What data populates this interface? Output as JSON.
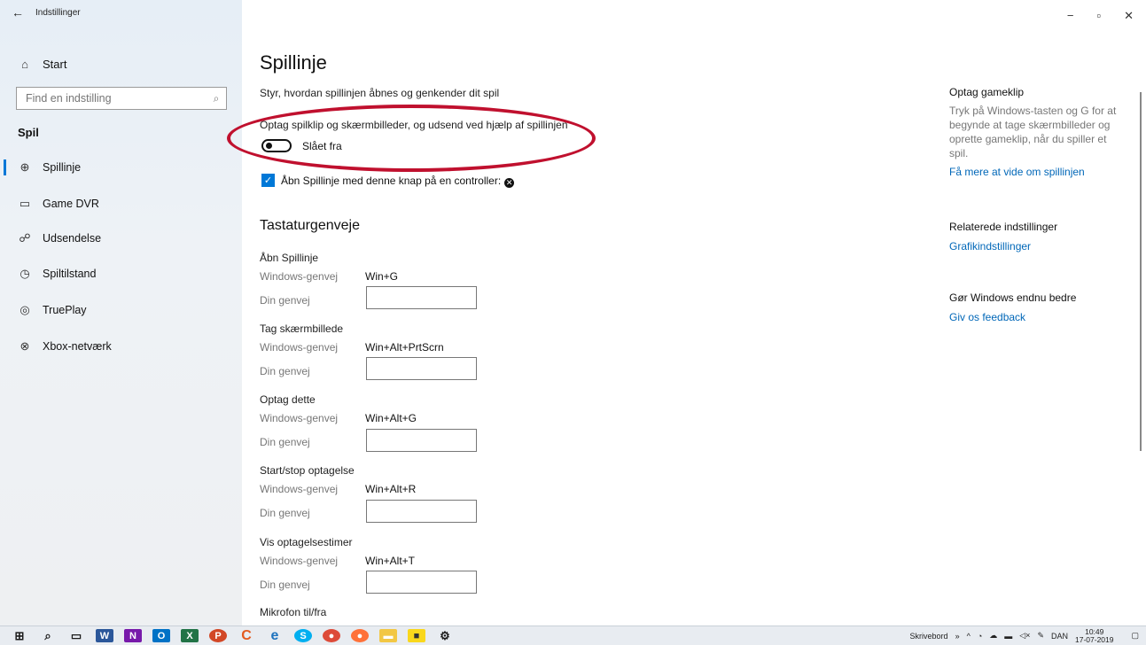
{
  "window": {
    "title": "Indstillinger",
    "back_icon": "←",
    "controls": {
      "minimize": "−",
      "maximize": "▫",
      "close": "✕"
    }
  },
  "sidebar": {
    "home_label": "Start",
    "search_placeholder": "Find en indstilling",
    "section_label": "Spil",
    "items": [
      {
        "label": "Spillinje",
        "icon": "game-bar-icon",
        "glyph": "⊕",
        "active": true
      },
      {
        "label": "Game DVR",
        "icon": "game-dvr-icon",
        "glyph": "▭",
        "active": false
      },
      {
        "label": "Udsendelse",
        "icon": "broadcast-icon",
        "glyph": "☍",
        "active": false
      },
      {
        "label": "Spiltilstand",
        "icon": "game-mode-icon",
        "glyph": "◷",
        "active": false
      },
      {
        "label": "TruePlay",
        "icon": "trueplay-icon",
        "glyph": "◎",
        "active": false
      },
      {
        "label": "Xbox-netværk",
        "icon": "xbox-icon",
        "glyph": "⊗",
        "active": false
      }
    ]
  },
  "main": {
    "title": "Spillinje",
    "subtitle": "Styr, hvordan spillinjen åbnes og genkender dit spil",
    "toggle_label": "Optag spilklip og skærmbilleder, og udsend ved hjælp af spillinjen",
    "toggle_state": "Slået fra",
    "toggle_on": false,
    "checkbox_label": "Åbn Spillinje med denne knap på en controller:",
    "checkbox_checked": true,
    "shortcuts_title": "Tastaturgenveje",
    "key_label": "Windows-genvej",
    "custom_label": "Din genvej",
    "shortcuts": [
      {
        "title": "Åbn Spillinje",
        "keys": "Win+G"
      },
      {
        "title": "Tag skærmbillede",
        "keys": "Win+Alt+PrtScrn"
      },
      {
        "title": "Optag dette",
        "keys": "Win+Alt+G"
      },
      {
        "title": "Start/stop optagelse",
        "keys": "Win+Alt+R"
      },
      {
        "title": "Vis optagelsestimer",
        "keys": "Win+Alt+T"
      },
      {
        "title": "Mikrofon til/fra"
      }
    ]
  },
  "right_panel": {
    "gameclip_title": "Optag gameklip",
    "gameclip_text": "Tryk på Windows-tasten og G for at begynde at tage skærmbilleder og oprette gameklip, når du spiller et spil.",
    "gameclip_link": "Få mere at vide om spillinjen",
    "related_title": "Relaterede indstillinger",
    "related_link": "Grafikindstillinger",
    "improve_title": "Gør Windows endnu bedre",
    "feedback_link": "Giv os feedback"
  },
  "taskbar": {
    "desktop_label": "Skrivebord",
    "language": "DAN",
    "time": "10:49",
    "date": "17-07-2019"
  },
  "colors": {
    "accent": "#0078d7",
    "link": "#0067b8",
    "annotation": "#c0102e"
  }
}
